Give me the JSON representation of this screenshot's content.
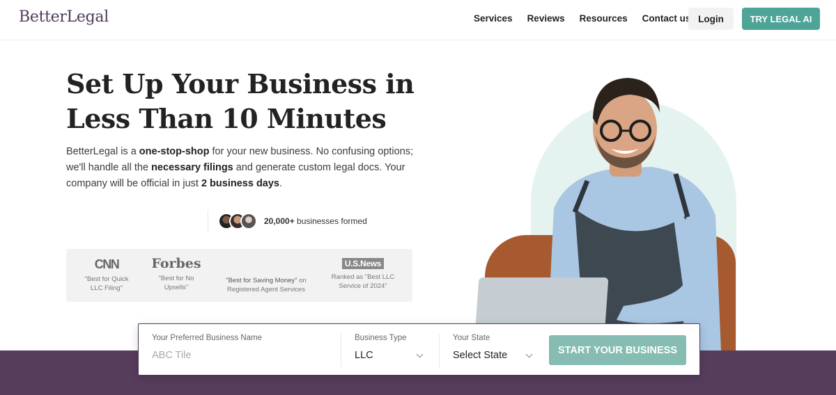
{
  "header": {
    "logo": "BetterLegal",
    "nav": [
      "Services",
      "Reviews",
      "Resources",
      "Contact us"
    ],
    "login_label": "Login",
    "cta_label": "TRY LEGAL AI"
  },
  "hero": {
    "title": "Set Up Your Business in Less Than 10 Minutes",
    "desc_parts": {
      "p1": "BetterLegal is a ",
      "b1": "one-stop-shop",
      "p2": " for your new business. No confusing options; we'll handle all the ",
      "b2": "necessary filings",
      "p3": " and generate custom legal docs. Your company will be official in just ",
      "b3": "2 business days",
      "p4": "."
    },
    "social_count": "20,000+",
    "social_text": " businesses formed"
  },
  "press": {
    "cnn": {
      "logo": "CNN",
      "caption": "\"Best for Quick LLC Filing\""
    },
    "forbes": {
      "logo": "Forbes",
      "caption": "\"Best for No Upsells\""
    },
    "saving": {
      "caption_bold": "\"Best for Saving Money\"",
      "caption_rest": " on Registered Agent Services"
    },
    "usnews": {
      "logo": "U.S.News",
      "caption": "Ranked as \"Best LLC Service of 2024\""
    }
  },
  "form": {
    "name_label": "Your Preferred Business Name",
    "name_placeholder": "ABC Tile",
    "type_label": "Business Type",
    "type_value": "LLC",
    "state_label": "Your State",
    "state_value": "Select State",
    "submit_label": "START YOUR BUSINESS"
  },
  "colors": {
    "brand_purple": "#563d5c",
    "accent_teal": "#4ea496",
    "button_teal_light": "#86bcb1"
  }
}
